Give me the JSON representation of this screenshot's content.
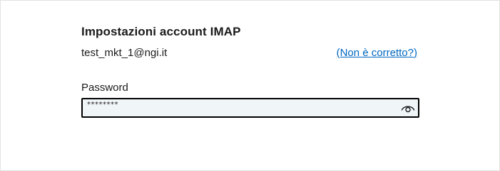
{
  "section": {
    "title": "Impostazioni account IMAP"
  },
  "account": {
    "email": "test_mkt_1@ngi.it",
    "change_link": "(Non è corretto?)"
  },
  "password": {
    "label": "Password",
    "value": "********",
    "reveal_icon": "eye-icon"
  },
  "colors": {
    "link": "#0067c0",
    "input_background": "#f0f5f8",
    "input_border": "#000000"
  }
}
